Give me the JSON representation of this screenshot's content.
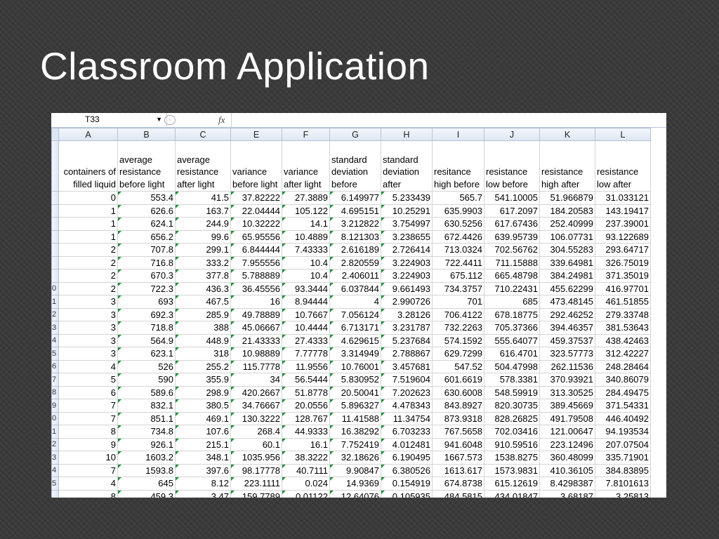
{
  "slide": {
    "title": "Classroom Application"
  },
  "formula_bar": {
    "name_box": "T33",
    "fx": "fx",
    "formula": ""
  },
  "columns": [
    "A",
    "B",
    "C",
    "E",
    "F",
    "G",
    "H",
    "I",
    "J",
    "K",
    "L"
  ],
  "headers": [
    "containers of filled liquid",
    "average resistance before light",
    "average resistance after light",
    "variance before light",
    "variance after light",
    "standard deviation before",
    "standard deviation after",
    "resitance high before",
    "resistance low before",
    "resistance high after",
    "resistance low after"
  ],
  "row_numbers": [
    "",
    "",
    "",
    "",
    "",
    "",
    "",
    "",
    "0",
    "1",
    "2",
    "3",
    "4",
    "5",
    "6",
    "7",
    "8",
    "9",
    "0",
    "1",
    "2",
    "3",
    "4",
    "5",
    ""
  ],
  "rows": [
    [
      "0",
      "553.4",
      "41.5",
      "37.82222",
      "27.3889",
      "6.149977",
      "5.233439",
      "565.7",
      "541.10005",
      "51.966879",
      "31.033121"
    ],
    [
      "1",
      "626.6",
      "163.7",
      "22.04444",
      "105.122",
      "4.695151",
      "10.25291",
      "635.9903",
      "617.2097",
      "184.20583",
      "143.19417"
    ],
    [
      "1",
      "624.1",
      "244.9",
      "10.32222",
      "14.1",
      "3.212822",
      "3.754997",
      "630.5256",
      "617.67436",
      "252.40999",
      "237.39001"
    ],
    [
      "1",
      "656.2",
      "99.6",
      "65.95556",
      "10.4889",
      "8.121303",
      "3.238655",
      "672.4426",
      "639.95739",
      "106.07731",
      "93.122689"
    ],
    [
      "2",
      "707.8",
      "299.1",
      "6.844444",
      "7.43333",
      "2.616189",
      "2.726414",
      "713.0324",
      "702.56762",
      "304.55283",
      "293.64717"
    ],
    [
      "2",
      "716.8",
      "333.2",
      "7.955556",
      "10.4",
      "2.820559",
      "3.224903",
      "722.4411",
      "711.15888",
      "339.64981",
      "326.75019"
    ],
    [
      "2",
      "670.3",
      "377.8",
      "5.788889",
      "10.4",
      "2.406011",
      "3.224903",
      "675.112",
      "665.48798",
      "384.24981",
      "371.35019"
    ],
    [
      "2",
      "722.3",
      "436.3",
      "36.45556",
      "93.3444",
      "6.037844",
      "9.661493",
      "734.3757",
      "710.22431",
      "455.62299",
      "416.97701"
    ],
    [
      "3",
      "693",
      "467.5",
      "16",
      "8.94444",
      "4",
      "2.990726",
      "701",
      "685",
      "473.48145",
      "461.51855"
    ],
    [
      "3",
      "692.3",
      "285.9",
      "49.78889",
      "10.7667",
      "7.056124",
      "3.28126",
      "706.4122",
      "678.18775",
      "292.46252",
      "279.33748"
    ],
    [
      "3",
      "718.8",
      "388",
      "45.06667",
      "10.4444",
      "6.713171",
      "3.231787",
      "732.2263",
      "705.37366",
      "394.46357",
      "381.53643"
    ],
    [
      "3",
      "564.9",
      "448.9",
      "21.43333",
      "27.4333",
      "4.629615",
      "5.237684",
      "574.1592",
      "555.64077",
      "459.37537",
      "438.42463"
    ],
    [
      "3",
      "623.1",
      "318",
      "10.98889",
      "7.77778",
      "3.314949",
      "2.788867",
      "629.7299",
      "616.4701",
      "323.57773",
      "312.42227"
    ],
    [
      "4",
      "526",
      "255.2",
      "115.7778",
      "11.9556",
      "10.76001",
      "3.457681",
      "547.52",
      "504.47998",
      "262.11536",
      "248.28464"
    ],
    [
      "5",
      "590",
      "355.9",
      "34",
      "56.5444",
      "5.830952",
      "7.519604",
      "601.6619",
      "578.3381",
      "370.93921",
      "340.86079"
    ],
    [
      "6",
      "589.6",
      "298.9",
      "420.2667",
      "51.8778",
      "20.50041",
      "7.202623",
      "630.6008",
      "548.59919",
      "313.30525",
      "284.49475"
    ],
    [
      "7",
      "832.1",
      "380.5",
      "34.76667",
      "20.0556",
      "5.896327",
      "4.478343",
      "843.8927",
      "820.30735",
      "389.45669",
      "371.54331"
    ],
    [
      "7",
      "851.1",
      "469.1",
      "130.3222",
      "128.767",
      "11.41588",
      "11.34754",
      "873.9318",
      "828.26825",
      "491.79508",
      "446.40492"
    ],
    [
      "8",
      "734.8",
      "107.6",
      "268.4",
      "44.9333",
      "16.38292",
      "6.703233",
      "767.5658",
      "702.03416",
      "121.00647",
      "94.193534"
    ],
    [
      "9",
      "926.1",
      "215.1",
      "60.1",
      "16.1",
      "7.752419",
      "4.012481",
      "941.6048",
      "910.59516",
      "223.12496",
      "207.07504"
    ],
    [
      "10",
      "1603.2",
      "348.1",
      "1035.956",
      "38.3222",
      "32.18626",
      "6.190495",
      "1667.573",
      "1538.8275",
      "360.48099",
      "335.71901"
    ],
    [
      "7",
      "1593.8",
      "397.6",
      "98.17778",
      "40.7111",
      "9.90847",
      "6.380526",
      "1613.617",
      "1573.9831",
      "410.36105",
      "384.83895"
    ],
    [
      "4",
      "645",
      "8.12",
      "223.1111",
      "0.024",
      "14.9369",
      "0.154919",
      "674.8738",
      "615.12619",
      "8.4298387",
      "7.8101613"
    ],
    [
      "8",
      "459.3",
      "3.47",
      "159.7789",
      "0.01122",
      "12.64076",
      "0.105935",
      "484.5815",
      "434.01847",
      "3.68187",
      "3.25813"
    ]
  ],
  "colors": {
    "background": "#3a3a3a",
    "title": "#ffffff",
    "error_triangle": "#1d8f3a"
  }
}
